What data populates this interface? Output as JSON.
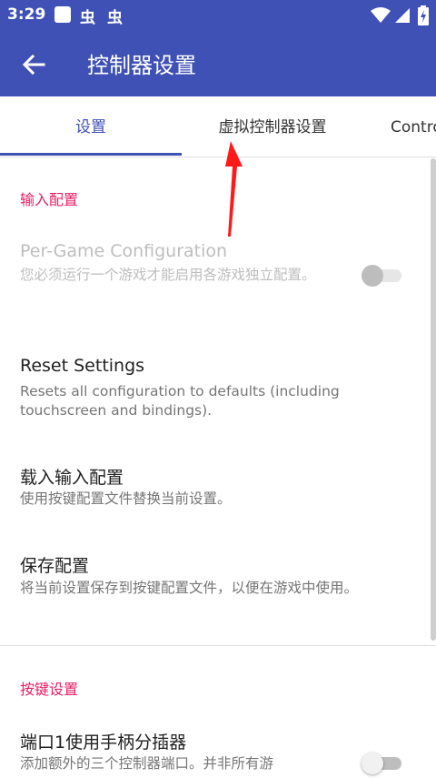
{
  "status_bar": {
    "time": "3:29",
    "glyph1": "虫",
    "glyph2": "虫",
    "icons": [
      "app-square-icon",
      "wifi-icon",
      "signal-icon",
      "battery-charging-icon"
    ]
  },
  "app_bar": {
    "title": "控制器设置",
    "back_icon": "back-arrow-icon",
    "color": "#3f51b5"
  },
  "tabs": [
    {
      "label": "设置",
      "active": true
    },
    {
      "label": "虚拟控制器设置",
      "active": false
    },
    {
      "label": "Contro",
      "active": false
    }
  ],
  "sections": [
    {
      "category": "输入配置",
      "items": [
        {
          "title": "Per-Game Configuration",
          "summary": "您必须运行一个游戏才能启用各游戏独立配置。",
          "enabled": false,
          "switch_on": false
        },
        {
          "title": "Reset Settings",
          "summary": "Resets all configuration to defaults (including touchscreen and bindings)."
        },
        {
          "title": "载入输入配置",
          "summary": "使用按键配置文件替换当前设置。"
        },
        {
          "title": "保存配置",
          "summary": "将当前设置保存到按键配置文件，以便在游戏中使用。"
        }
      ]
    },
    {
      "category": "按键设置",
      "items": [
        {
          "title": "端口1使用手柄分插器",
          "summary": "添加额外的三个控制器端口。并非所有游",
          "switch_on": false
        }
      ]
    }
  ],
  "colors": {
    "primary": "#3f51b5",
    "accent": "#e91e63",
    "annotation_arrow": "#ff1a1a"
  }
}
